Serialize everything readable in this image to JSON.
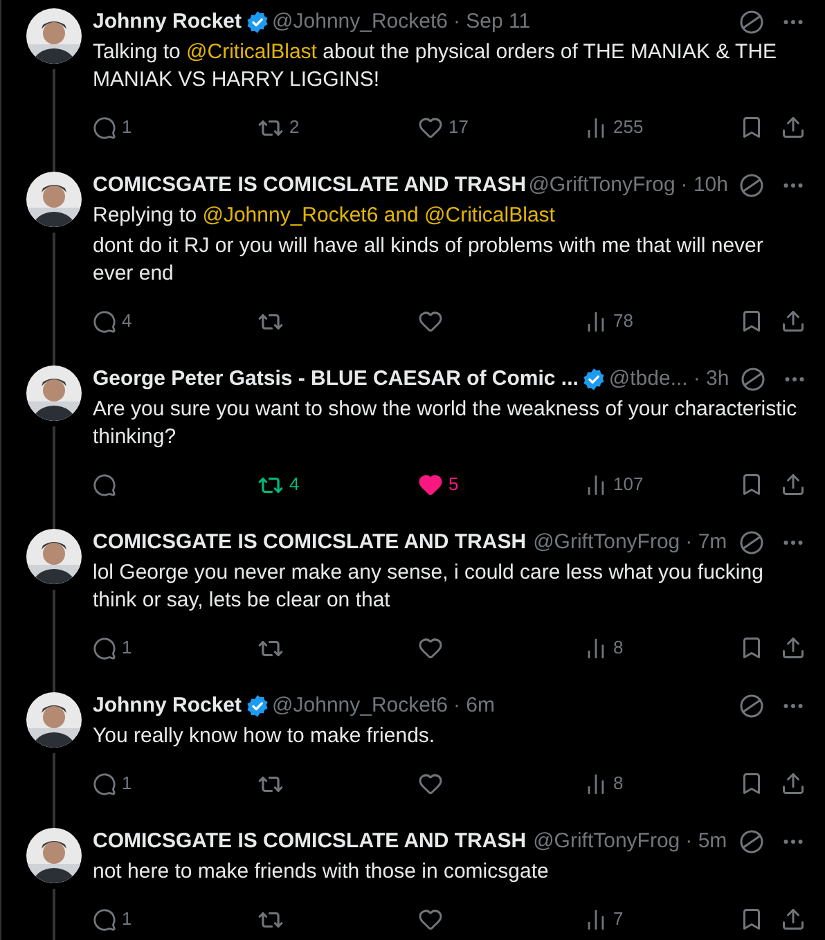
{
  "tweets": [
    {
      "name": "Johnny Rocket",
      "verified": true,
      "handle": "@Johnny_Rocket6",
      "time": "· Sep 11",
      "connected": true,
      "body": [
        {
          "kind": "text",
          "text": "Talking to "
        },
        {
          "kind": "mention",
          "text": "@CriticalBlast"
        },
        {
          "kind": "text",
          "text": " about the physical orders of THE MANIAK & THE MANIAK VS HARRY LIGGINS!"
        }
      ],
      "actions": {
        "replies": "1",
        "retweets": "2",
        "retweeted": false,
        "likes": "17",
        "liked": false,
        "views": "255"
      }
    },
    {
      "name": "COMICSGATE IS COMICSLATE AND TRASH",
      "verified": false,
      "handle": "@GriftTonyFrog",
      "time": "· 10h",
      "connected": true,
      "replying_to": [
        {
          "kind": "text",
          "text": "Replying to "
        },
        {
          "kind": "mention",
          "text": "@Johnny_Rocket6 and @CriticalBlast"
        }
      ],
      "body": [
        {
          "kind": "text",
          "text": "dont do it RJ or you will have all kinds of problems with me that will never ever end"
        }
      ],
      "actions": {
        "replies": "4",
        "retweeted": false,
        "liked": false,
        "views": "78"
      }
    },
    {
      "name": "George Peter Gatsis - BLUE CAESAR of Comic ...",
      "verified": true,
      "handle": "@tbde...",
      "time": "· 3h",
      "connected": true,
      "body": [
        {
          "kind": "text",
          "text": "Are you sure you want to show the world the weakness of your characteristic thinking?"
        }
      ],
      "actions": {
        "retweets": "4",
        "retweeted": true,
        "likes": "5",
        "liked": true,
        "views": "107"
      }
    },
    {
      "name": "COMICSGATE IS COMICSLATE AND TRASH",
      "verified": false,
      "handle": "@GriftTonyFrog",
      "time": "· 7m",
      "connected": true,
      "body": [
        {
          "kind": "text",
          "text": "lol George you never make any sense, i could care less what you fucking think or say, lets be clear on that"
        }
      ],
      "actions": {
        "replies": "1",
        "retweeted": false,
        "liked": false,
        "views": "8"
      }
    },
    {
      "name": "Johnny Rocket",
      "verified": true,
      "handle": "@Johnny_Rocket6",
      "time": "· 6m",
      "connected": true,
      "body": [
        {
          "kind": "text",
          "text": "You really know how to make friends."
        }
      ],
      "actions": {
        "replies": "1",
        "retweeted": false,
        "liked": false,
        "views": "8"
      }
    },
    {
      "name": "COMICSGATE IS COMICSLATE AND TRASH",
      "verified": false,
      "handle": "@GriftTonyFrog",
      "time": "· 5m",
      "connected": true,
      "body": [
        {
          "kind": "text",
          "text": "not here to make friends with those in comicsgate"
        }
      ],
      "actions": {
        "replies": "1",
        "retweeted": false,
        "liked": false,
        "views": "7"
      }
    }
  ]
}
